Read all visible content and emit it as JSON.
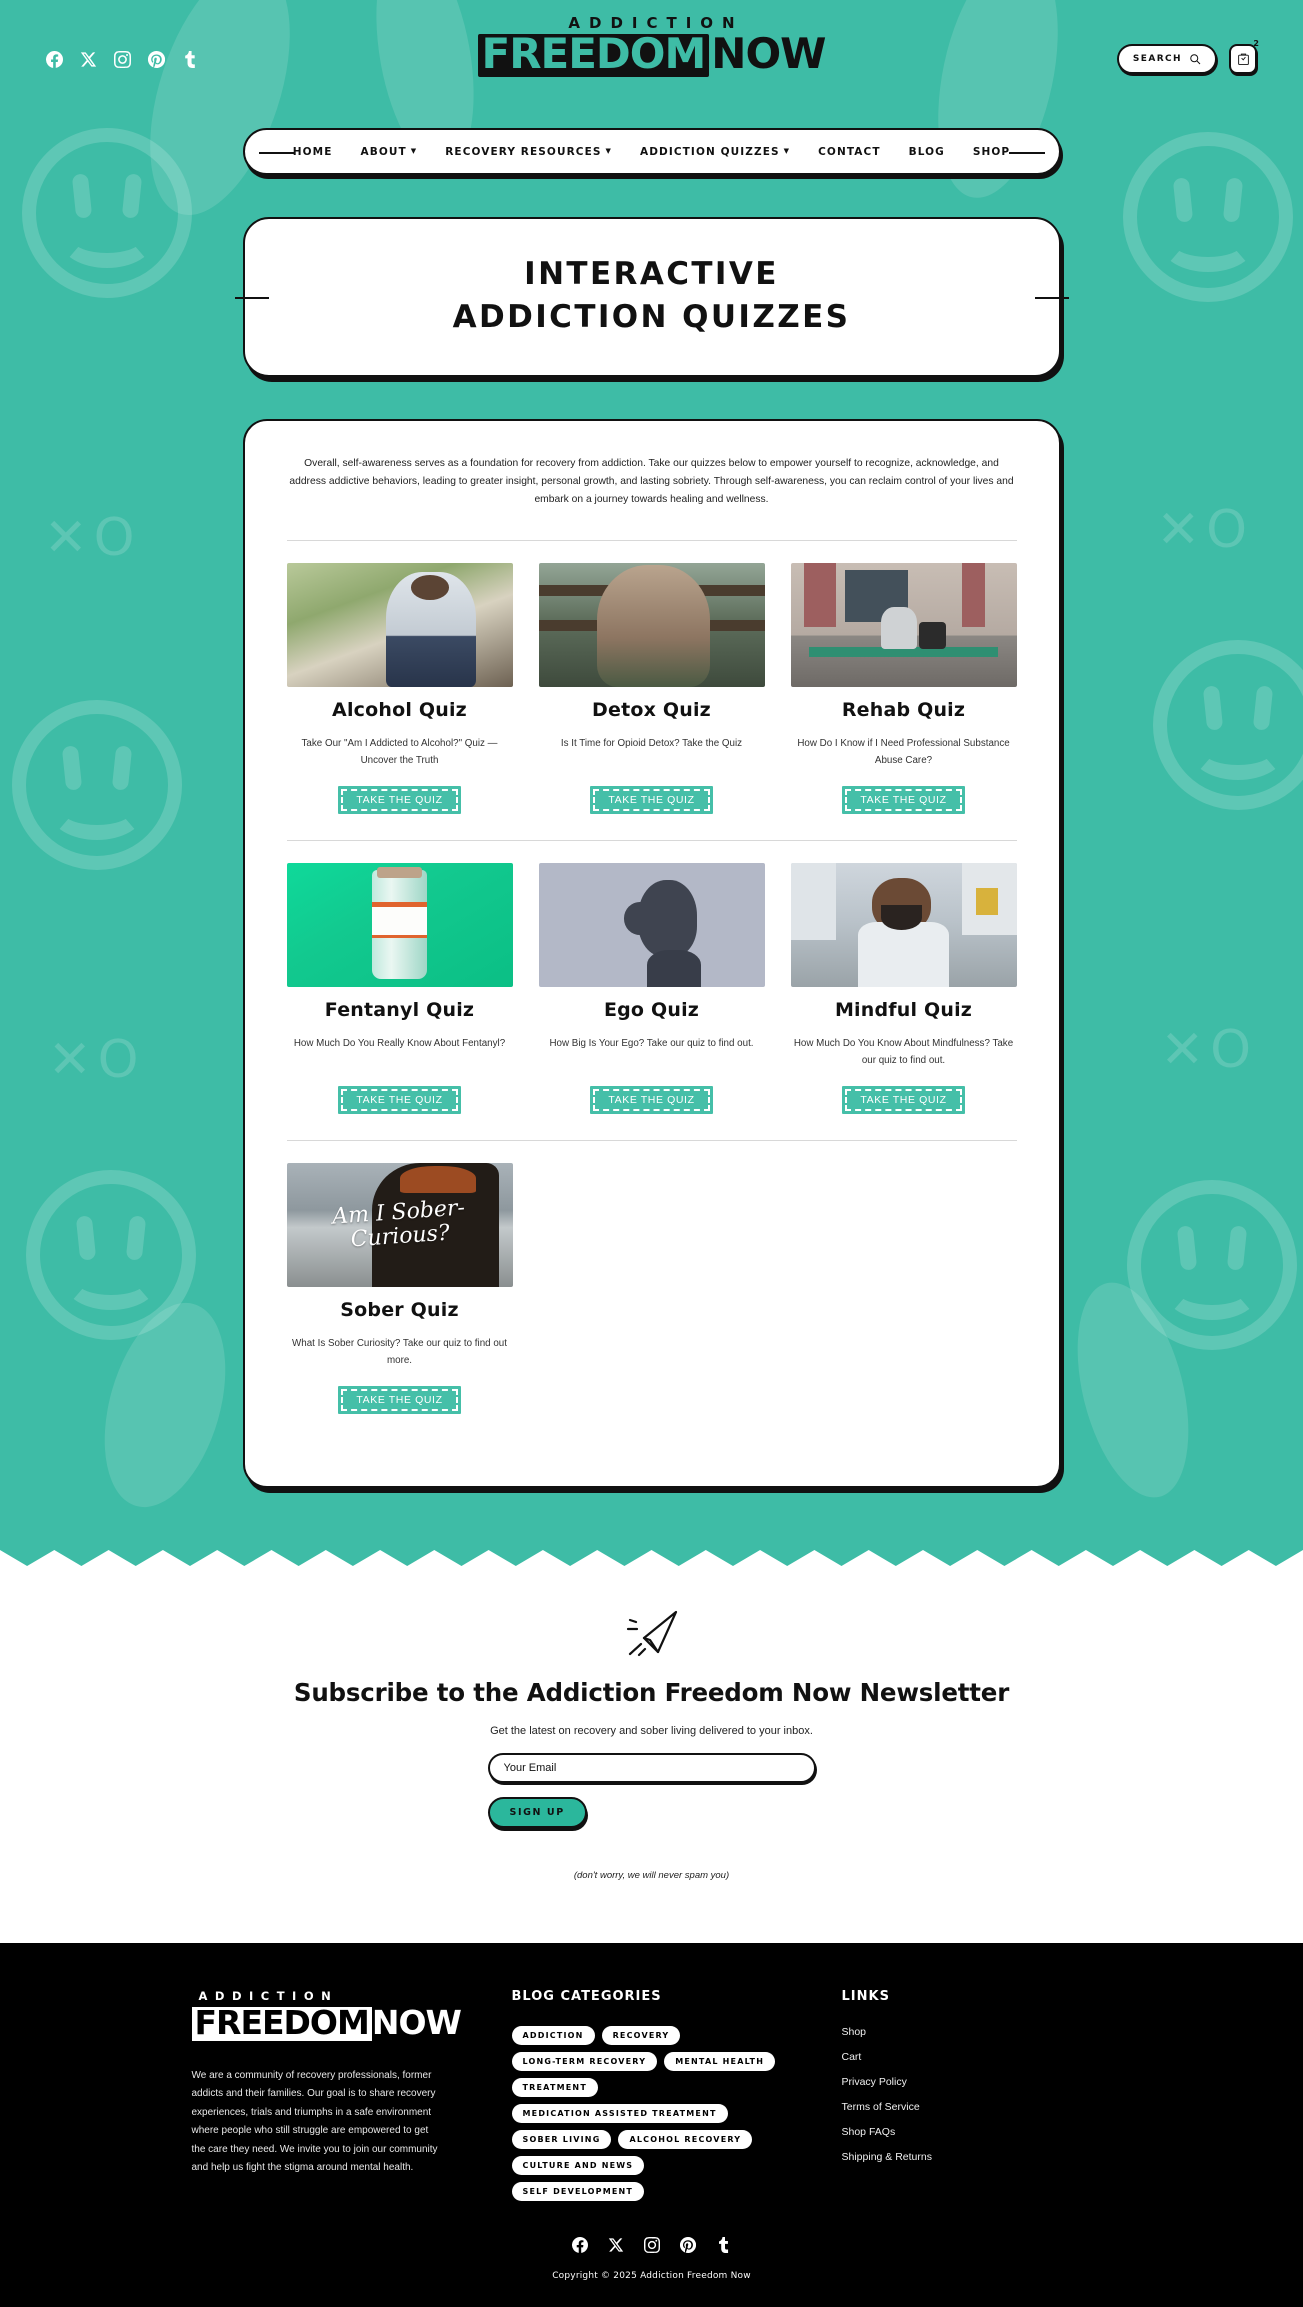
{
  "header": {
    "logo": {
      "top": "ADDICTION",
      "main_boxed": "FREEDOM",
      "main_plain": "NOW"
    },
    "social": [
      {
        "name": "facebook-icon",
        "label": "Facebook"
      },
      {
        "name": "x-icon",
        "label": "X"
      },
      {
        "name": "instagram-icon",
        "label": "Instagram"
      },
      {
        "name": "pinterest-icon",
        "label": "Pinterest"
      },
      {
        "name": "tumblr-icon",
        "label": "Tumblr"
      }
    ],
    "search_label": "SEARCH",
    "cart_count": "2"
  },
  "nav": {
    "items": [
      {
        "label": "HOME",
        "has_caret": false
      },
      {
        "label": "ABOUT",
        "has_caret": true
      },
      {
        "label": "RECOVERY RESOURCES",
        "has_caret": true
      },
      {
        "label": "ADDICTION QUIZZES",
        "has_caret": true
      },
      {
        "label": "CONTACT",
        "has_caret": false
      },
      {
        "label": "BLOG",
        "has_caret": false
      },
      {
        "label": "SHOP",
        "has_caret": false
      }
    ],
    "caret": "▼"
  },
  "hero": {
    "line1": "INTERACTIVE",
    "line2": "ADDICTION QUIZZES"
  },
  "main": {
    "intro": "Overall, self-awareness serves as a foundation for recovery from addiction. Take our quizzes below to empower yourself to recognize, acknowledge, and address addictive behaviors, leading to greater insight, personal growth, and lasting sobriety. Through self-awareness, you can reclaim control of your lives and embark on a journey towards healing and wellness.",
    "quiz_button_label": "TAKE THE QUIZ",
    "rows": [
      [
        {
          "title": "Alcohol Quiz",
          "desc": "Take Our \"Am I Addicted to Alcohol?\" Quiz — Uncover the Truth",
          "thumb": "man-sitting-head-in-hands-outdoors"
        },
        {
          "title": "Detox Quiz",
          "desc": "Is It Time for Opioid Detox? Take the Quiz",
          "thumb": "woman-resting-head-on-arm-on-bench"
        },
        {
          "title": "Rehab Quiz",
          "desc": "How Do I Know if I Need Professional Substance Abuse Care?",
          "thumb": "person-sitting-alone-on-bench"
        }
      ],
      [
        {
          "title": "Fentanyl Quiz",
          "desc": "How Much Do You Really Know About Fentanyl?",
          "thumb": "fentanyl-citrate-vial"
        },
        {
          "title": "Ego Quiz",
          "desc": "How Big Is Your Ego? Take our quiz to find out.",
          "thumb": "silhouette-profile-portrait"
        },
        {
          "title": "Mindful Quiz",
          "desc": "How Much Do You Know About Mindfulness? Take our quiz to find out.",
          "thumb": "man-meditating-on-street"
        }
      ],
      [
        {
          "title": "Sober Quiz",
          "desc": "What Is Sober Curiosity? Take our quiz to find out more.",
          "thumb": "am-i-sober-curious-beach-portrait",
          "overlay": "Am I Sober-Curious?"
        }
      ]
    ]
  },
  "newsletter": {
    "title": "Subscribe to the Addiction Freedom Now Newsletter",
    "subtitle": "Get the latest on recovery and sober living delivered to your inbox.",
    "email_placeholder": "Your Email",
    "email_value": "",
    "button_label": "SIGN UP",
    "note": "(don't worry, we will never spam you)"
  },
  "footer": {
    "logo": {
      "top": "ADDICTION",
      "main_boxed": "FREEDOM",
      "main_plain": "NOW"
    },
    "about": "We are a community of recovery professionals, former addicts and their families. Our goal is to share recovery experiences, trials and triumphs in a safe environment where people who still struggle are empowered to get the care they need. We invite you to join our community and help us fight the stigma around mental health.",
    "categories_heading": "BLOG CATEGORIES",
    "categories": [
      "ADDICTION",
      "RECOVERY",
      "LONG-TERM RECOVERY",
      "MENTAL HEALTH",
      "TREATMENT",
      "MEDICATION ASSISTED TREATMENT",
      "SOBER LIVING",
      "ALCOHOL RECOVERY",
      "CULTURE AND NEWS",
      "SELF DEVELOPMENT"
    ],
    "links_heading": "LINKS",
    "links": [
      "Shop",
      "Cart",
      "Privacy Policy",
      "Terms of Service",
      "Shop FAQs",
      "Shipping & Returns"
    ],
    "social": [
      {
        "name": "facebook-icon",
        "label": "Facebook"
      },
      {
        "name": "x-icon",
        "label": "X"
      },
      {
        "name": "instagram-icon",
        "label": "Instagram"
      },
      {
        "name": "pinterest-icon",
        "label": "Pinterest"
      },
      {
        "name": "tumblr-icon",
        "label": "Tumblr"
      }
    ],
    "copyright": "Copyright © 2025 Addiction Freedom Now"
  },
  "colors": {
    "teal": "#3ebca6",
    "teal_button": "#45bfa8",
    "signup_teal": "#2bb79c",
    "black": "#000000",
    "white": "#ffffff"
  }
}
